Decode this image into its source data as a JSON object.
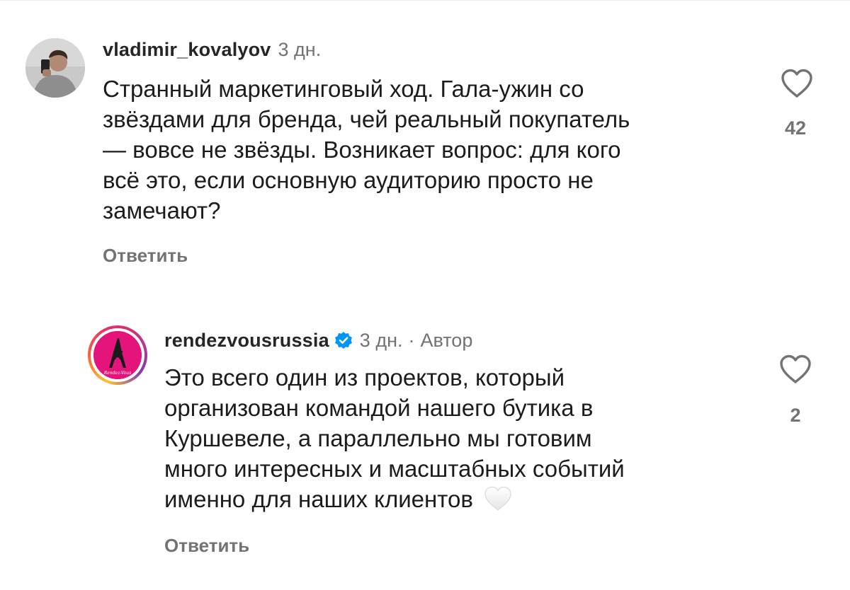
{
  "comments": [
    {
      "username": "vladimir_kovalyov",
      "time": "3 дн.",
      "lines": [
        "Странный маркетинговый ход. Гала-ужин со",
        "звёздами для бренда, чей реальный покупатель",
        "— вовсе не звёзды. Возникает вопрос: для кого",
        "всё это, если основную аудиторию просто не",
        "замечают?"
      ],
      "reply_label": "Ответить",
      "likes": "42",
      "avatar_icon": "user-photo-avatar"
    },
    {
      "username": "rendezvousrussia",
      "verified": true,
      "time": "3 дн.",
      "separator": "·",
      "author_tag": "Автор",
      "lines": [
        "Это всего один из проектов, который",
        "организован командой нашего бутика в",
        "Куршевеле, а параллельно мы готовим",
        "много интересных и масштабных событий",
        "именно для наших клиентов"
      ],
      "emoji": "white-heart-emoji",
      "reply_label": "Ответить",
      "likes": "2",
      "avatar_icon": "brand-logo-avatar",
      "logo_text": "Rendez-Vous"
    }
  ],
  "colors": {
    "text": "#1c1c1c",
    "muted": "#737373",
    "verified_blue": "#0095f6",
    "brand_pink": "#e5147a"
  }
}
